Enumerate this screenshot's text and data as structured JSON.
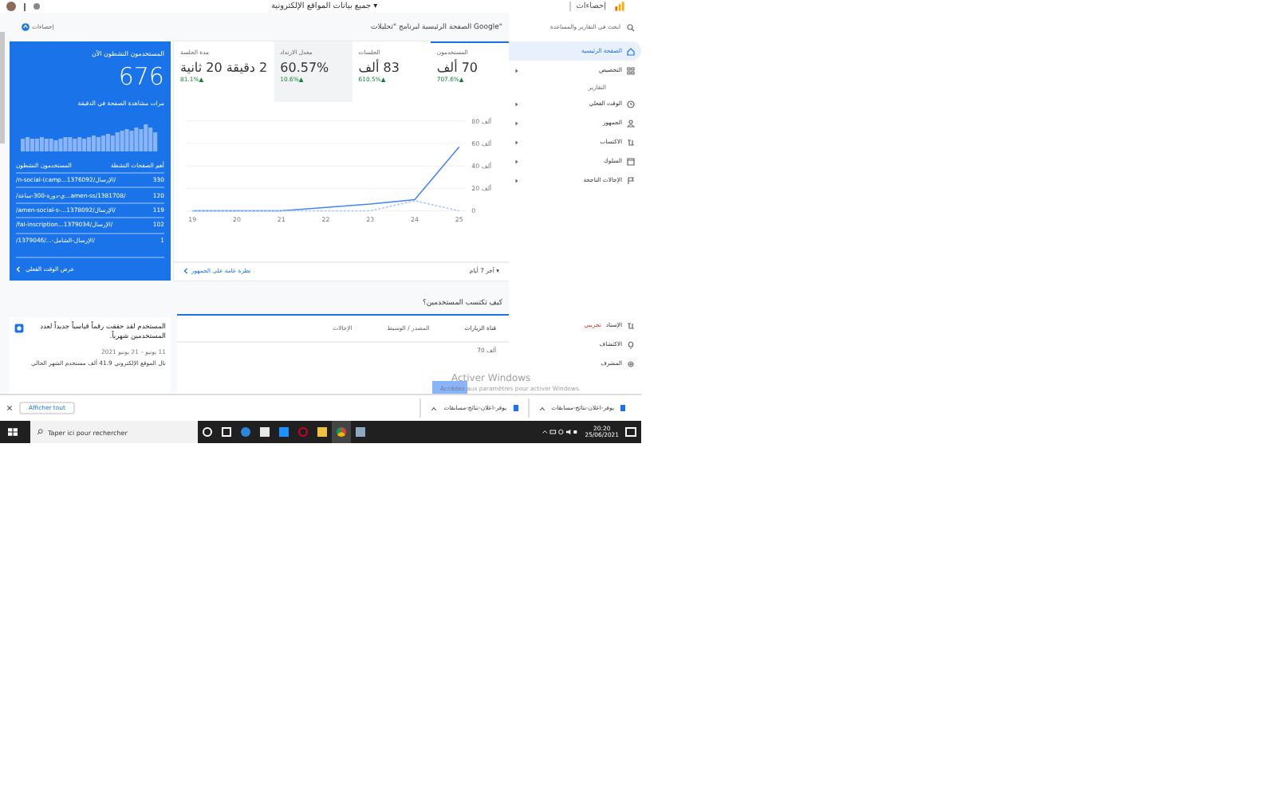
{
  "browser": {
    "page_title": "جميع بيانات المواقع الإلكترونية ▾",
    "product": "إحصاءات"
  },
  "logo": {
    "label": "إحصاءات"
  },
  "sidebar": {
    "search_placeholder": "ابحث في التقارير والمساعدة",
    "items": [
      {
        "kind": "item",
        "label": "الصفحة الرئيسية",
        "selected": true,
        "expandable": false
      },
      {
        "kind": "item",
        "label": "التخصيص",
        "selected": false,
        "expandable": true
      },
      {
        "kind": "section",
        "label": "التقارير"
      },
      {
        "kind": "item",
        "label": "الوقت الفعلي",
        "selected": false,
        "expandable": true
      },
      {
        "kind": "item",
        "label": "الجمهور",
        "selected": false,
        "expandable": true
      },
      {
        "kind": "item",
        "label": "الاكتساب",
        "selected": false,
        "expandable": true
      },
      {
        "kind": "item",
        "label": "السلوك",
        "selected": false,
        "expandable": true
      },
      {
        "kind": "item",
        "label": "الإحالات الناجحة",
        "selected": false,
        "expandable": true
      }
    ],
    "bottom_items": [
      {
        "label": "الإسناد",
        "badge": "تجريبي"
      },
      {
        "label": "الاكتشاف"
      },
      {
        "label": "المشرف"
      }
    ]
  },
  "home_title": "الصفحة الرئيسية لبرنامج \"تحليلات Google\"",
  "realtime": {
    "title": "المستخدمون النشطون الآن",
    "value": "676",
    "subtitle": "مرات مشاهدة الصفحة في الدقيقة",
    "col_pages": "أهم الصفحات النشطة",
    "col_users": "المستخدمون النشطون",
    "rows": [
      {
        "page": "/n-social-(camp...الإرسال/1376092/",
        "users": "330"
      },
      {
        "page": "/ي-دورة-300-ساعة...amen-ss/1381708/",
        "users": "120"
      },
      {
        "page": "/amen-social-s-...الإرسال/1378092/",
        "users": "119"
      },
      {
        "page": "/fal-inscription...الإرسال/1379034/",
        "users": "102"
      },
      {
        "page": "/الإرسال-الشامل-.../1379046/",
        "users": "1"
      }
    ],
    "link": "عرض الوقت الفعلي"
  },
  "overview": {
    "tabs": [
      {
        "label": "المستخدمون",
        "value": "70 ألف",
        "change": "▲707.6%",
        "selected": true,
        "highlighted": false
      },
      {
        "label": "الجلسات",
        "value": "83 ألف",
        "change": "▲610.5%",
        "selected": false,
        "highlighted": false
      },
      {
        "label": "معدل الارتداد",
        "value": "60.57%",
        "change": "▲10.6%",
        "selected": false,
        "highlighted": true
      },
      {
        "label": "مدة الجلسة",
        "value": "2 دقيقة 20 ثانية",
        "change": "▲81.1%",
        "selected": false,
        "highlighted": false
      }
    ],
    "chart_data": {
      "type": "line",
      "grid": true,
      "categories": [
        "19",
        "20",
        "21",
        "22",
        "23",
        "24",
        "25"
      ],
      "ylim": [
        0,
        80
      ],
      "yticks": [
        {
          "value": 0,
          "label": "0"
        },
        {
          "value": 20,
          "label": "20 ألف"
        },
        {
          "value": 40,
          "label": "40 ألف"
        },
        {
          "value": 60,
          "label": "60 ألف"
        },
        {
          "value": 80,
          "label": "80 ألف"
        }
      ],
      "series": [
        {
          "color": "#4285f4",
          "line_style": "solid",
          "values": [
            0,
            0,
            0,
            3,
            6,
            10,
            57
          ]
        },
        {
          "color": "#a8c7fa",
          "line_style": "dashed",
          "values": [
            0,
            0,
            0,
            0,
            0,
            9,
            0
          ]
        }
      ]
    },
    "period": "آخر 7 أيام ▾",
    "link": "نظرة عامة على الجمهور"
  },
  "acquisition": {
    "title": "كيف تكتسب المستخدمين؟",
    "tabs": [
      {
        "label": "قناة الزيارات",
        "selected": true
      },
      {
        "label": "المصدر / الوسيط",
        "selected": false
      },
      {
        "label": "الإحالات",
        "selected": false
      }
    ],
    "tick": "70 ألف"
  },
  "insight": {
    "title": "المستخدم لقد حققت رقماً قياسياً جديداً لعدد المستخدمين شهرياً.",
    "date": "11 يونيو – 21 يونيو 2021",
    "text": "نال الموقع الإلكتروني 41.9 ألف مستخدم الشهر الحالي"
  },
  "activation": {
    "title": "Activer Windows",
    "text": "Accédez aux paramètres pour activer Windows."
  },
  "downloads": {
    "show_all": "Afficher tout",
    "items": [
      "يوفر-اعلان-نتائج-مسابقات",
      "يوفر-اعلان-نتائج-مسابقات"
    ]
  },
  "taskbar": {
    "search_placeholder": "Taper ici pour rechercher",
    "time": "20:20",
    "date": "25/06/2021"
  }
}
